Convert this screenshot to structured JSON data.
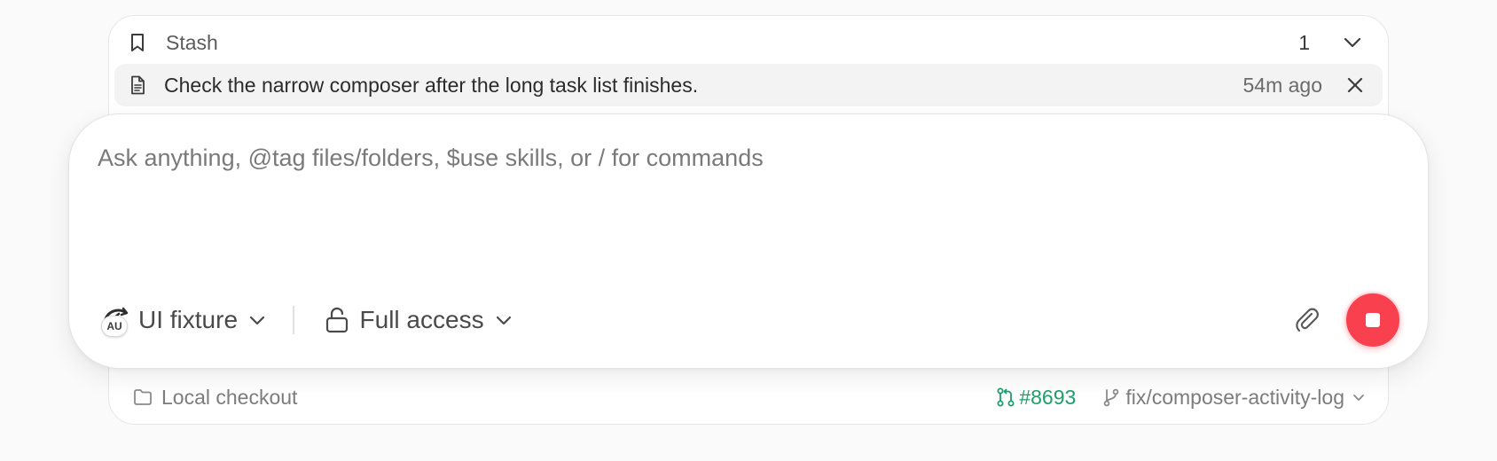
{
  "stash": {
    "title": "Stash",
    "count": "1",
    "items": [
      {
        "text": "Check the narrow composer after the long task list finishes.",
        "time": "54m ago"
      }
    ]
  },
  "composer": {
    "placeholder": "Ask anything, @tag files/folders, $use skills, or / for commands",
    "model": {
      "badge": "AU",
      "label": "UI fixture"
    },
    "access": {
      "label": "Full access"
    }
  },
  "footer": {
    "workspace": "Local checkout",
    "pr": "#8693",
    "branch": "fix/composer-activity-log"
  },
  "colors": {
    "stop": "#f9404e",
    "pr": "#1f9d6c"
  },
  "icons": {
    "stash": "bookmark-icon",
    "stash_item": "document-icon",
    "toggle": "chevron-down-icon",
    "close": "close-icon",
    "model": "fixture-avatar-icon",
    "access": "unlock-icon",
    "attach": "paperclip-icon",
    "stop": "stop-icon",
    "workspace": "folder-icon",
    "pr": "pull-request-icon",
    "branch": "git-branch-icon"
  }
}
